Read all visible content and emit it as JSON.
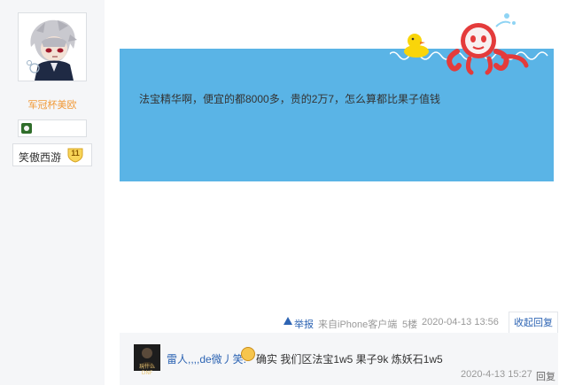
{
  "author": {
    "username": "军冠杯美欧",
    "level_label": "笑傲西游",
    "level_number": "11"
  },
  "post": {
    "content": "法宝精华啊，便宜的都8000多，贵的2万7，怎么算都比果子值钱",
    "report_label": "举报",
    "source": "来自iPhone客户端",
    "floor": "5楼",
    "time": "2020-04-13 13:56",
    "collapse_label": "收起回复"
  },
  "reply": {
    "user": "雷人,,,,de微丿笑:",
    "avatar_caption": "玩什么DNF",
    "content": "确实 我们区法宝1w5 果子9k 炼妖石1w5",
    "time": "2020-4-13 15:27",
    "reply_label": "回复"
  }
}
